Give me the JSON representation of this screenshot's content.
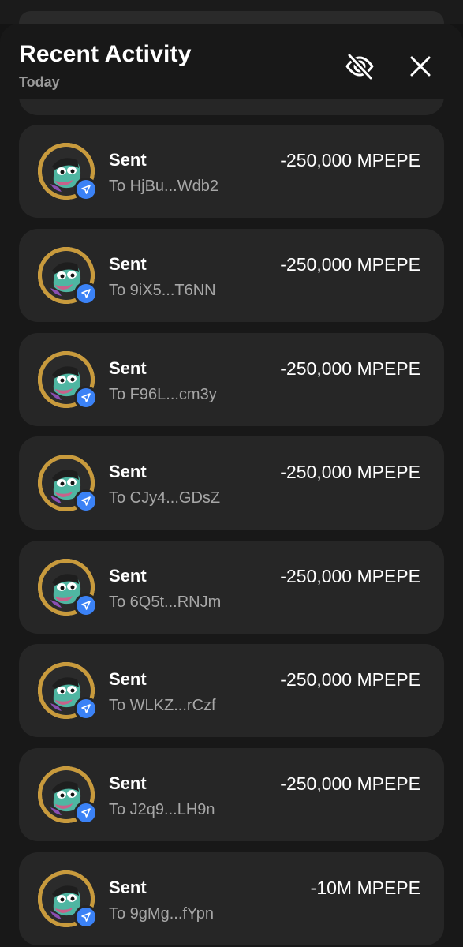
{
  "header": {
    "title": "Recent Activity",
    "subtitle": "Today"
  },
  "icons": {
    "hide": "eye-slash-icon",
    "close": "close-icon",
    "badge": "send-arrow-icon",
    "avatar": "token-avatar-icon"
  },
  "colors": {
    "background": "#181818",
    "card": "#262626",
    "badge": "#3b82f6",
    "avatar_ring": "#d4a84b"
  },
  "transactions": [
    {
      "label": "Sent",
      "address": "To HjBu...Wdb2",
      "amount": "-250,000 MPEPE"
    },
    {
      "label": "Sent",
      "address": "To 9iX5...T6NN",
      "amount": "-250,000 MPEPE"
    },
    {
      "label": "Sent",
      "address": "To F96L...cm3y",
      "amount": "-250,000 MPEPE"
    },
    {
      "label": "Sent",
      "address": "To CJy4...GDsZ",
      "amount": "-250,000 MPEPE"
    },
    {
      "label": "Sent",
      "address": "To 6Q5t...RNJm",
      "amount": "-250,000 MPEPE"
    },
    {
      "label": "Sent",
      "address": "To WLKZ...rCzf",
      "amount": "-250,000 MPEPE"
    },
    {
      "label": "Sent",
      "address": "To J2q9...LH9n",
      "amount": "-250,000 MPEPE"
    },
    {
      "label": "Sent",
      "address": "To 9gMg...fYpn",
      "amount": "-10M MPEPE"
    }
  ]
}
